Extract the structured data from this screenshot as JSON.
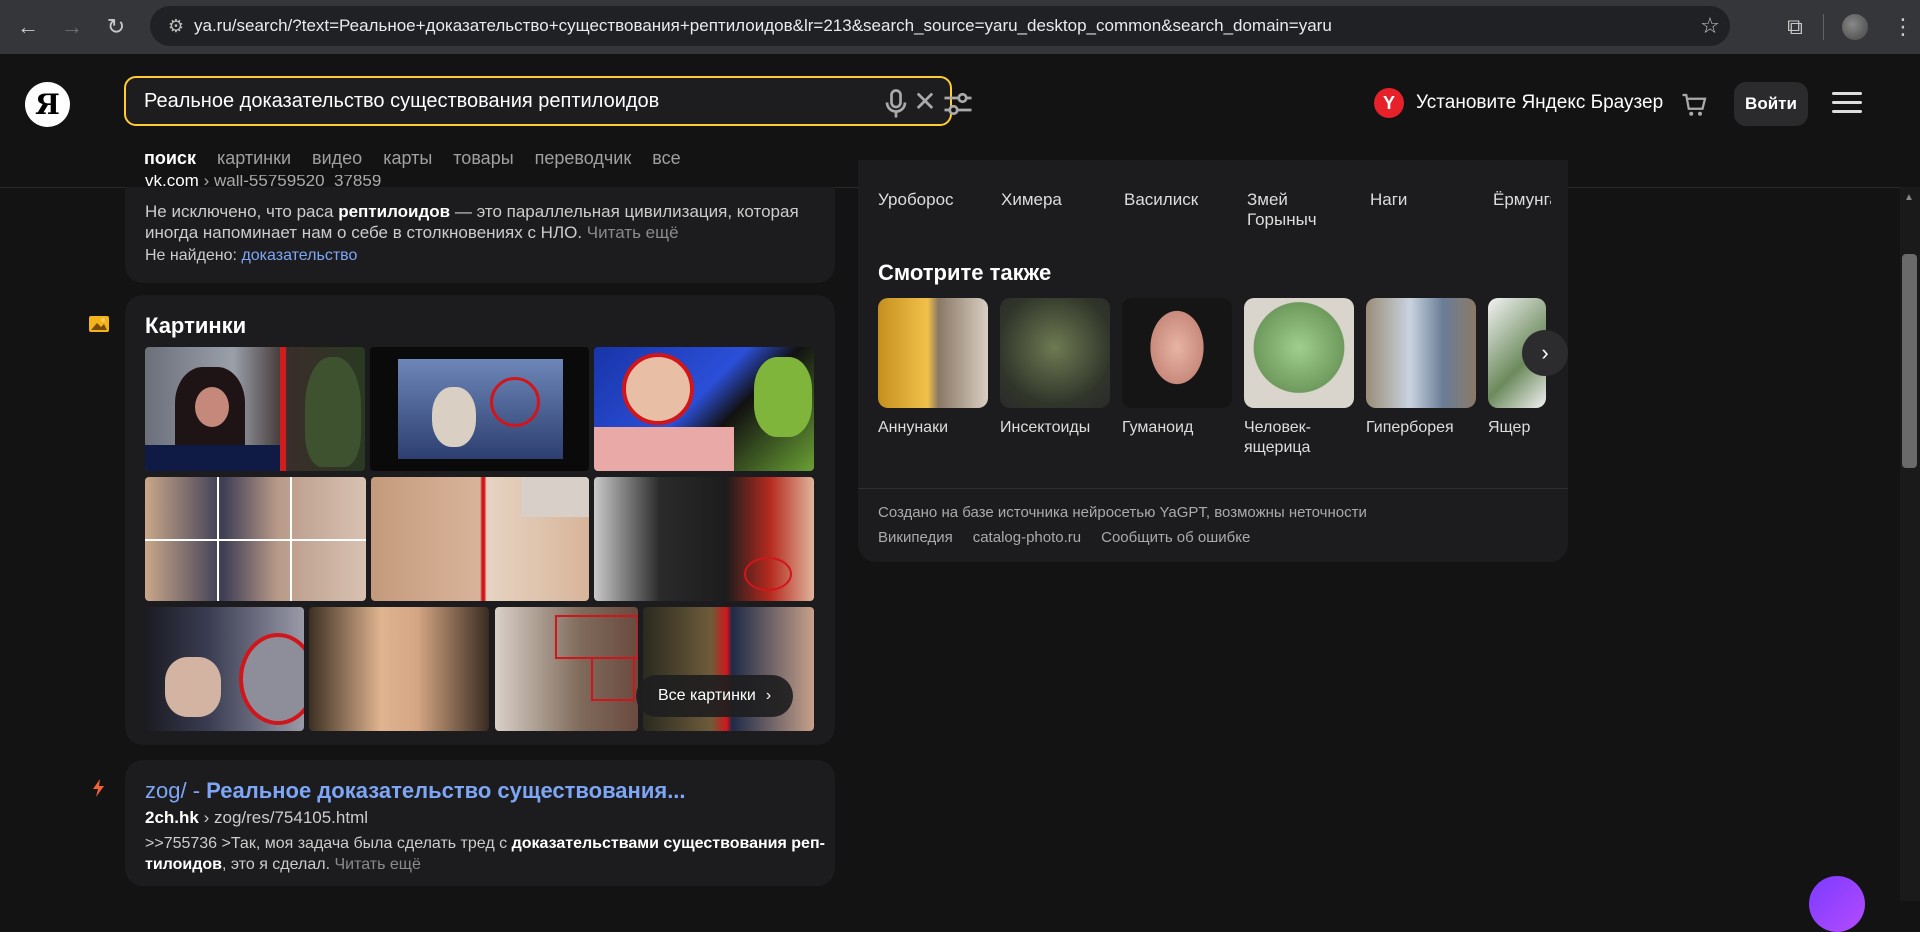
{
  "browser": {
    "url": "ya.ru/search/?text=Реальное+доказательство+существования+рептилоидов&lr=213&search_source=yaru_desktop_common&search_domain=yaru"
  },
  "header": {
    "logo": "Я",
    "query": "Реальное доказательство существования рептилоидов",
    "promo": "Установите Яндекс Браузер",
    "login": "Войти",
    "tabs": [
      "поиск",
      "картинки",
      "видео",
      "карты",
      "товары",
      "переводчик",
      "все"
    ]
  },
  "snippet_top": {
    "source": "vk.com",
    "crumb": "wall-55759520_37859",
    "text_before": "Не исключено, что раса ",
    "text_bold": "рептилоидов",
    "text_after": " — это параллельная цивилизация, которая иногда напоминает нам о себе в столкновениях с НЛО.",
    "readmore": "Читать ещё",
    "notfound_label": "Не найдено:",
    "notfound_word": "доказательство"
  },
  "images": {
    "title": "Картинки",
    "all_button": "Все картинки"
  },
  "result": {
    "title_prefix": "zog/ - ",
    "title_bold": "Реальное доказательство существования...",
    "host": "2ch.hk",
    "crumb": "zog/res/754105.html",
    "text_before": ">>755736 >Так, моя задача была сделать тред с ",
    "text_bold1": "доказательствами существования реп-тилоидов",
    "text_after": ", это я сделал.",
    "readmore": "Читать ещё"
  },
  "right": {
    "myths": [
      "Уроборос",
      "Химера",
      "Василиск",
      "Змей Горыныч",
      "Наги",
      "Ёрмунганд"
    ],
    "see_also_title": "Смотрите также",
    "see_also": [
      "Аннунаки",
      "Инсектоиды",
      "Гуманоид",
      "Человек-ящерица",
      "Гиперборея",
      "Ящер"
    ],
    "ai_note": "Создано на базе источника нейросетью YaGPT, возможны неточности",
    "ai_links": [
      "Википедия",
      "catalog-photo.ru",
      "Сообщить об ошибке"
    ]
  },
  "colors": {
    "accent_search_border": "#ffcc33",
    "link": "#7ea6f6",
    "yandex_red": "#e6212a"
  }
}
